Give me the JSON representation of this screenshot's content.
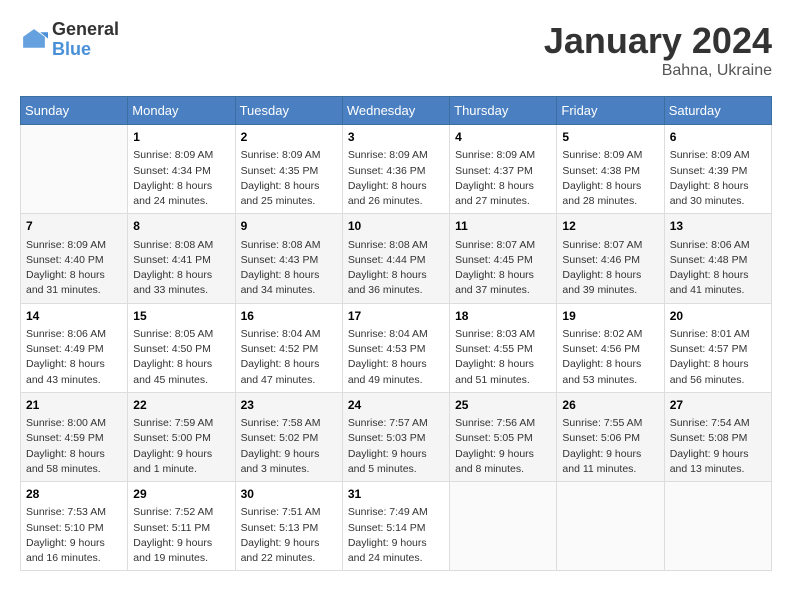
{
  "header": {
    "logo_general": "General",
    "logo_blue": "Blue",
    "month_title": "January 2024",
    "location": "Bahna, Ukraine"
  },
  "weekdays": [
    "Sunday",
    "Monday",
    "Tuesday",
    "Wednesday",
    "Thursday",
    "Friday",
    "Saturday"
  ],
  "weeks": [
    [
      {
        "day": "",
        "info": ""
      },
      {
        "day": "1",
        "info": "Sunrise: 8:09 AM\nSunset: 4:34 PM\nDaylight: 8 hours\nand 24 minutes."
      },
      {
        "day": "2",
        "info": "Sunrise: 8:09 AM\nSunset: 4:35 PM\nDaylight: 8 hours\nand 25 minutes."
      },
      {
        "day": "3",
        "info": "Sunrise: 8:09 AM\nSunset: 4:36 PM\nDaylight: 8 hours\nand 26 minutes."
      },
      {
        "day": "4",
        "info": "Sunrise: 8:09 AM\nSunset: 4:37 PM\nDaylight: 8 hours\nand 27 minutes."
      },
      {
        "day": "5",
        "info": "Sunrise: 8:09 AM\nSunset: 4:38 PM\nDaylight: 8 hours\nand 28 minutes."
      },
      {
        "day": "6",
        "info": "Sunrise: 8:09 AM\nSunset: 4:39 PM\nDaylight: 8 hours\nand 30 minutes."
      }
    ],
    [
      {
        "day": "7",
        "info": "Sunrise: 8:09 AM\nSunset: 4:40 PM\nDaylight: 8 hours\nand 31 minutes."
      },
      {
        "day": "8",
        "info": "Sunrise: 8:08 AM\nSunset: 4:41 PM\nDaylight: 8 hours\nand 33 minutes."
      },
      {
        "day": "9",
        "info": "Sunrise: 8:08 AM\nSunset: 4:43 PM\nDaylight: 8 hours\nand 34 minutes."
      },
      {
        "day": "10",
        "info": "Sunrise: 8:08 AM\nSunset: 4:44 PM\nDaylight: 8 hours\nand 36 minutes."
      },
      {
        "day": "11",
        "info": "Sunrise: 8:07 AM\nSunset: 4:45 PM\nDaylight: 8 hours\nand 37 minutes."
      },
      {
        "day": "12",
        "info": "Sunrise: 8:07 AM\nSunset: 4:46 PM\nDaylight: 8 hours\nand 39 minutes."
      },
      {
        "day": "13",
        "info": "Sunrise: 8:06 AM\nSunset: 4:48 PM\nDaylight: 8 hours\nand 41 minutes."
      }
    ],
    [
      {
        "day": "14",
        "info": "Sunrise: 8:06 AM\nSunset: 4:49 PM\nDaylight: 8 hours\nand 43 minutes."
      },
      {
        "day": "15",
        "info": "Sunrise: 8:05 AM\nSunset: 4:50 PM\nDaylight: 8 hours\nand 45 minutes."
      },
      {
        "day": "16",
        "info": "Sunrise: 8:04 AM\nSunset: 4:52 PM\nDaylight: 8 hours\nand 47 minutes."
      },
      {
        "day": "17",
        "info": "Sunrise: 8:04 AM\nSunset: 4:53 PM\nDaylight: 8 hours\nand 49 minutes."
      },
      {
        "day": "18",
        "info": "Sunrise: 8:03 AM\nSunset: 4:55 PM\nDaylight: 8 hours\nand 51 minutes."
      },
      {
        "day": "19",
        "info": "Sunrise: 8:02 AM\nSunset: 4:56 PM\nDaylight: 8 hours\nand 53 minutes."
      },
      {
        "day": "20",
        "info": "Sunrise: 8:01 AM\nSunset: 4:57 PM\nDaylight: 8 hours\nand 56 minutes."
      }
    ],
    [
      {
        "day": "21",
        "info": "Sunrise: 8:00 AM\nSunset: 4:59 PM\nDaylight: 8 hours\nand 58 minutes."
      },
      {
        "day": "22",
        "info": "Sunrise: 7:59 AM\nSunset: 5:00 PM\nDaylight: 9 hours\nand 1 minute."
      },
      {
        "day": "23",
        "info": "Sunrise: 7:58 AM\nSunset: 5:02 PM\nDaylight: 9 hours\nand 3 minutes."
      },
      {
        "day": "24",
        "info": "Sunrise: 7:57 AM\nSunset: 5:03 PM\nDaylight: 9 hours\nand 5 minutes."
      },
      {
        "day": "25",
        "info": "Sunrise: 7:56 AM\nSunset: 5:05 PM\nDaylight: 9 hours\nand 8 minutes."
      },
      {
        "day": "26",
        "info": "Sunrise: 7:55 AM\nSunset: 5:06 PM\nDaylight: 9 hours\nand 11 minutes."
      },
      {
        "day": "27",
        "info": "Sunrise: 7:54 AM\nSunset: 5:08 PM\nDaylight: 9 hours\nand 13 minutes."
      }
    ],
    [
      {
        "day": "28",
        "info": "Sunrise: 7:53 AM\nSunset: 5:10 PM\nDaylight: 9 hours\nand 16 minutes."
      },
      {
        "day": "29",
        "info": "Sunrise: 7:52 AM\nSunset: 5:11 PM\nDaylight: 9 hours\nand 19 minutes."
      },
      {
        "day": "30",
        "info": "Sunrise: 7:51 AM\nSunset: 5:13 PM\nDaylight: 9 hours\nand 22 minutes."
      },
      {
        "day": "31",
        "info": "Sunrise: 7:49 AM\nSunset: 5:14 PM\nDaylight: 9 hours\nand 24 minutes."
      },
      {
        "day": "",
        "info": ""
      },
      {
        "day": "",
        "info": ""
      },
      {
        "day": "",
        "info": ""
      }
    ]
  ]
}
